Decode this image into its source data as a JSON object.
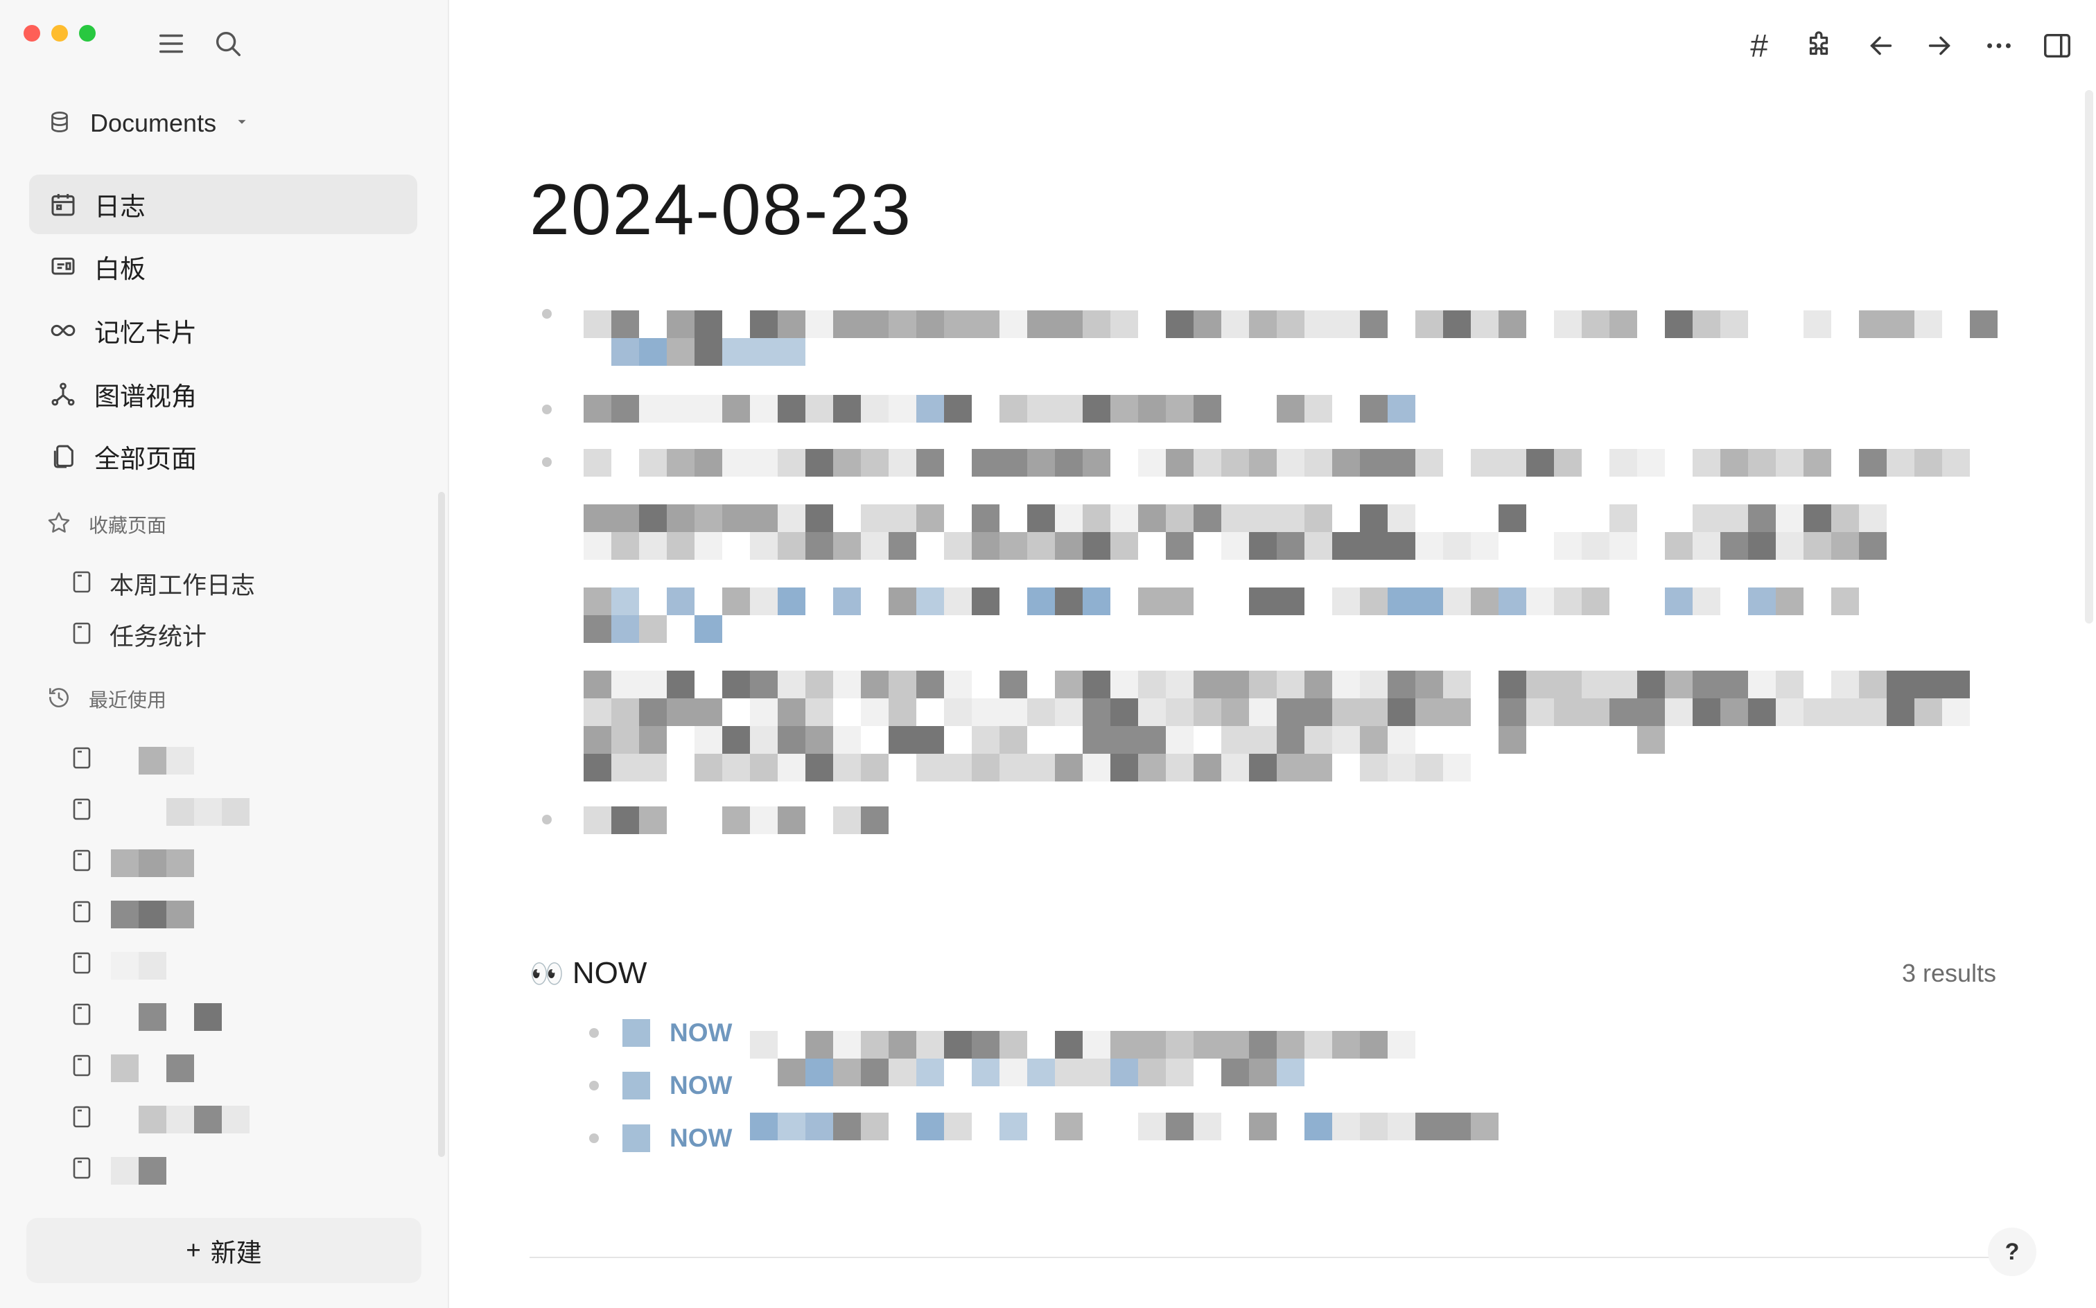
{
  "window": {
    "controls": [
      "close",
      "minimize",
      "zoom"
    ]
  },
  "sidebar": {
    "toolbar_icons": [
      "menu-icon",
      "search-icon"
    ],
    "graph": {
      "name": "Documents"
    },
    "nav": [
      {
        "label": "日志",
        "icon": "calendar-icon",
        "active": true
      },
      {
        "label": "白板",
        "icon": "whiteboard-icon"
      },
      {
        "label": "记忆卡片",
        "icon": "infinity-icon"
      },
      {
        "label": "图谱视角",
        "icon": "graph-icon"
      },
      {
        "label": "全部页面",
        "icon": "pages-icon"
      }
    ],
    "favorites": {
      "heading": "收藏页面",
      "items": [
        {
          "label": "本周工作日志"
        },
        {
          "label": "任务统计"
        }
      ]
    },
    "recent": {
      "heading": "最近使用",
      "item_count_visible": 9
    },
    "new_button": {
      "plus": "+",
      "label": "新建"
    }
  },
  "toolbar": {
    "icons": [
      "sync-status-icon",
      "hashtag-icon",
      "plugin-icon",
      "back-arrow-icon",
      "forward-arrow-icon",
      "more-icon",
      "sidebar-toggle-icon"
    ],
    "hashtag": "#",
    "colors": {
      "sync_status": "#22b04b"
    }
  },
  "page": {
    "title": "2024-08-23",
    "query": {
      "emoji": "👀",
      "title": "NOW",
      "count_text": "3 results",
      "rows": [
        {
          "marker": "NOW",
          "checkbox": true
        },
        {
          "marker": "NOW",
          "checkbox": true
        },
        {
          "marker": "NOW",
          "checkbox": true
        }
      ]
    },
    "help_label": "?"
  },
  "colors": {
    "sidebar_bg": "#f7f7f7",
    "active_nav_bg": "#e9e9e9",
    "now_marker": "#6f97be"
  }
}
